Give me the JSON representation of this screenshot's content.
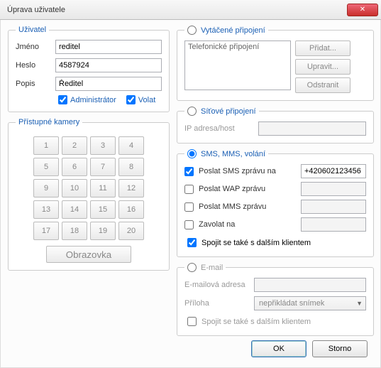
{
  "window": {
    "title": "Úprava uživatele",
    "close": "✕"
  },
  "user": {
    "legend": "Uživatel",
    "name_label": "Jméno",
    "name_value": "reditel",
    "pass_label": "Heslo",
    "pass_value": "4587924",
    "desc_label": "Popis",
    "desc_value": "Ředitel",
    "admin_label": "Administrátor",
    "admin_checked": true,
    "call_label": "Volat",
    "call_checked": true
  },
  "cameras": {
    "legend": "Přístupné kamery",
    "keys": [
      "1",
      "2",
      "3",
      "4",
      "5",
      "6",
      "7",
      "8",
      "9",
      "10",
      "11",
      "12",
      "13",
      "14",
      "15",
      "16",
      "17",
      "18",
      "19",
      "20"
    ],
    "screen_btn": "Obrazovka"
  },
  "dial": {
    "legend": "Vytáčené připojení",
    "item": "Telefonické připojení",
    "add": "Přidat...",
    "edit": "Upravit...",
    "remove": "Odstranit"
  },
  "net": {
    "legend": "Síťové připojení",
    "ip_label": "IP adresa/host",
    "ip_value": ""
  },
  "sms": {
    "legend": "SMS, MMS, volání",
    "send_sms_label": "Poslat SMS zprávu na",
    "send_sms_checked": true,
    "send_sms_value": "+420602123456",
    "send_wap_label": "Poslat WAP zprávu",
    "send_wap_checked": false,
    "send_wap_value": "",
    "send_mms_label": "Poslat MMS zprávu",
    "send_mms_checked": false,
    "send_mms_value": "",
    "call_label": "Zavolat na",
    "call_checked": false,
    "call_value": "",
    "connect_label": "Spojit se také s dalším klientem",
    "connect_checked": true
  },
  "email": {
    "legend": "E-mail",
    "addr_label": "E-mailová adresa",
    "addr_value": "",
    "attach_label": "Příloha",
    "attach_value": "nepřikládat snímek",
    "connect_label": "Spojit se také s dalším klientem",
    "connect_checked": false
  },
  "footer": {
    "ok": "OK",
    "cancel": "Storno"
  }
}
